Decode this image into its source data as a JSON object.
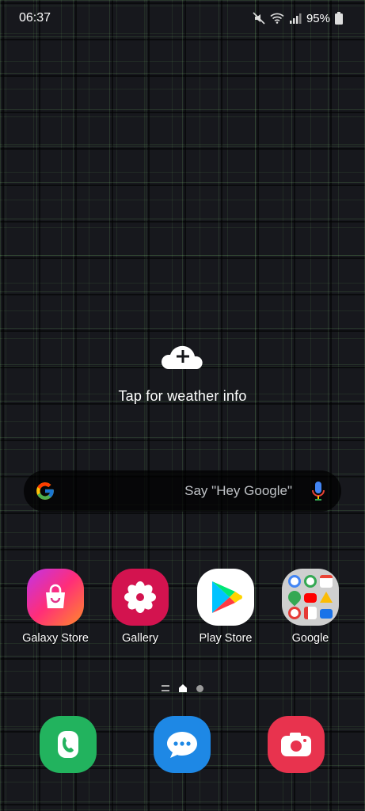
{
  "status_bar": {
    "time": "06:37",
    "battery": "95%",
    "icons": [
      "mute-icon",
      "wifi-icon",
      "signal-icon",
      "battery-icon"
    ]
  },
  "weather": {
    "text": "Tap for weather info",
    "icon": "cloud-plus-icon"
  },
  "search": {
    "hint": "Say \"Hey Google\"",
    "icons": [
      "google-logo-icon",
      "mic-icon"
    ]
  },
  "apps": [
    {
      "label": "Galaxy Store",
      "icon": "galaxy-store-icon",
      "color": "#e91e63"
    },
    {
      "label": "Gallery",
      "icon": "gallery-flower-icon",
      "color": "#d81b60"
    },
    {
      "label": "Play Store",
      "icon": "play-store-icon",
      "color": "#ffffff"
    },
    {
      "label": "Google",
      "icon": "google-folder-icon",
      "color": "#c9c9c9"
    }
  ],
  "page_indicator": {
    "pages": 3,
    "current": 2
  },
  "dock": [
    {
      "icon": "phone-icon",
      "color": "#1db954"
    },
    {
      "icon": "messages-icon",
      "color": "#1e88e5"
    },
    {
      "icon": "camera-icon",
      "color": "#e53950"
    }
  ]
}
